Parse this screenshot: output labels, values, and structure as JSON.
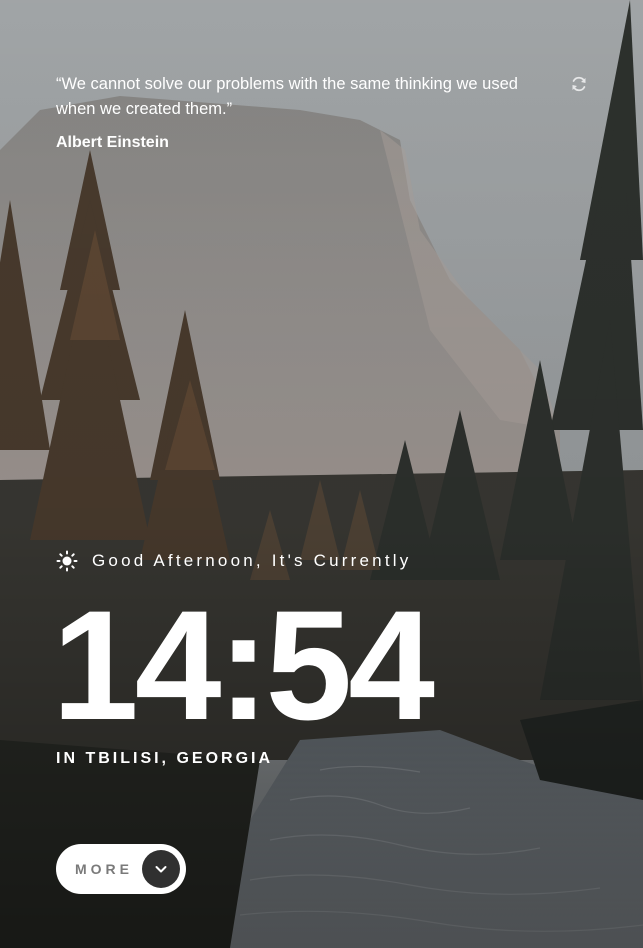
{
  "quote": {
    "text": "“We cannot solve our problems with the same thinking we used when we created them.”",
    "author": "Albert Einstein",
    "refresh_icon": "refresh-icon"
  },
  "greeting": {
    "icon": "sun-icon",
    "text": "Good Afternoon, It's Currently"
  },
  "clock": {
    "time": "14:54",
    "location": "IN TBILISI, GEORGIA"
  },
  "more_button": {
    "label": "MORE",
    "icon": "chevron-down-icon"
  },
  "colors": {
    "text": "#ffffff",
    "button_bg": "#ffffff",
    "button_label": "#7a7a7a",
    "button_circle": "#303030"
  }
}
